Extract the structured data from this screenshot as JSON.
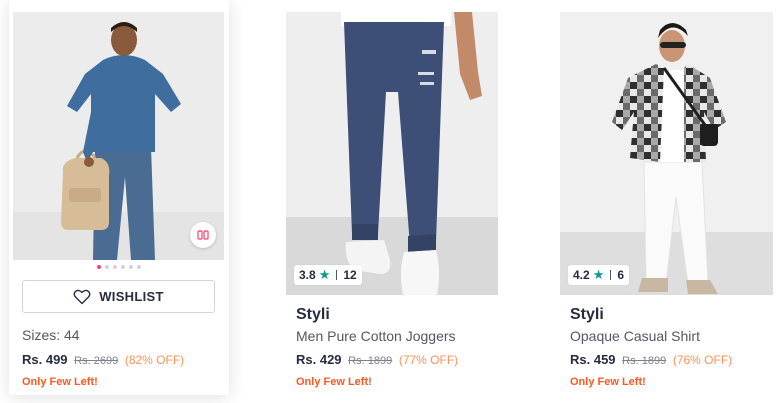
{
  "products": [
    {
      "wishlist_label": "WISHLIST",
      "sizes": "Sizes: 44",
      "price": "Rs. 499",
      "mrp": "Rs. 2699",
      "discount": "(82% OFF)",
      "stock_note": "Only Few Left!",
      "image_icon": "denim-shirt-man-photo",
      "similar_icon": "view-similar-icon"
    },
    {
      "brand": "Styli",
      "name": "Men Pure Cotton Joggers",
      "rating": "3.8",
      "rating_count": "12",
      "price": "Rs. 429",
      "mrp": "Rs. 1899",
      "discount": "(77% OFF)",
      "stock_note": "Only Few Left!",
      "image_icon": "navy-joggers-photo"
    },
    {
      "brand": "Styli",
      "name": "Opaque Casual Shirt",
      "rating": "4.2",
      "rating_count": "6",
      "price": "Rs. 459",
      "mrp": "Rs. 1899",
      "discount": "(76% OFF)",
      "stock_note": "Only Few Left!",
      "image_icon": "check-shirt-man-photo"
    }
  ],
  "colors": {
    "accent": "#ff3f6c",
    "discount": "#ff905a",
    "few_left": "#ff5722",
    "rating_star": "#14958f"
  }
}
